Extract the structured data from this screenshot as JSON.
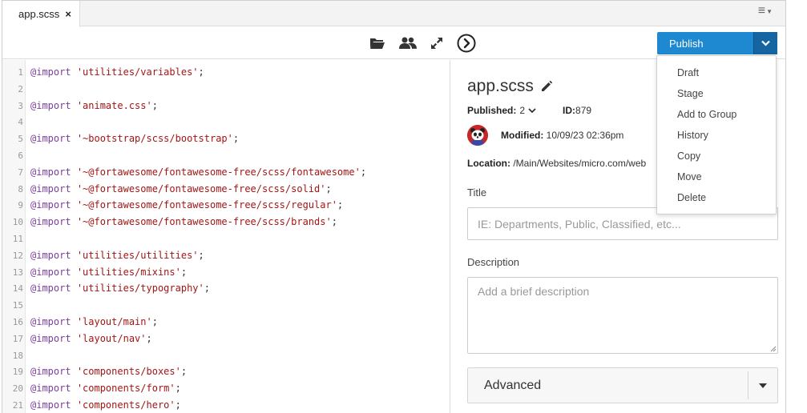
{
  "tab": {
    "title": "app.scss",
    "close_symbol": "×"
  },
  "menu": {
    "icon": "hamburger-menu-icon",
    "glyph": "≡"
  },
  "toolbar": {
    "icons": [
      "folder-open-icon",
      "users-icon",
      "expand-icon",
      "circle-arrow-right-icon"
    ],
    "publish_label": "Publish"
  },
  "dropdown": {
    "items": [
      "Draft",
      "Stage",
      "Add to Group",
      "History",
      "Copy",
      "Move",
      "Delete"
    ]
  },
  "editor": {
    "lines": [
      {
        "num": "1",
        "kw": "@import",
        "str": "'utilities/variables'",
        "end": ";"
      },
      {
        "num": "2",
        "kw": "",
        "str": "",
        "end": ""
      },
      {
        "num": "3",
        "kw": "@import",
        "str": "'animate.css'",
        "end": ";"
      },
      {
        "num": "4",
        "kw": "",
        "str": "",
        "end": ""
      },
      {
        "num": "5",
        "kw": "@import",
        "str": "'~bootstrap/scss/bootstrap'",
        "end": ";"
      },
      {
        "num": "6",
        "kw": "",
        "str": "",
        "end": ""
      },
      {
        "num": "7",
        "kw": "@import",
        "str": "'~@fortawesome/fontawesome-free/scss/fontawesome'",
        "end": ";"
      },
      {
        "num": "8",
        "kw": "@import",
        "str": "'~@fortawesome/fontawesome-free/scss/solid'",
        "end": ";"
      },
      {
        "num": "9",
        "kw": "@import",
        "str": "'~@fortawesome/fontawesome-free/scss/regular'",
        "end": ";"
      },
      {
        "num": "10",
        "kw": "@import",
        "str": "'~@fortawesome/fontawesome-free/scss/brands'",
        "end": ";"
      },
      {
        "num": "11",
        "kw": "",
        "str": "",
        "end": ""
      },
      {
        "num": "12",
        "kw": "@import",
        "str": "'utilities/utilities'",
        "end": ";"
      },
      {
        "num": "13",
        "kw": "@import",
        "str": "'utilities/mixins'",
        "end": ";"
      },
      {
        "num": "14",
        "kw": "@import",
        "str": "'utilities/typography'",
        "end": ";"
      },
      {
        "num": "15",
        "kw": "",
        "str": "",
        "end": ""
      },
      {
        "num": "16",
        "kw": "@import",
        "str": "'layout/main'",
        "end": ";"
      },
      {
        "num": "17",
        "kw": "@import",
        "str": "'layout/nav'",
        "end": ";"
      },
      {
        "num": "18",
        "kw": "",
        "str": "",
        "end": ""
      },
      {
        "num": "19",
        "kw": "@import",
        "str": "'components/boxes'",
        "end": ";"
      },
      {
        "num": "20",
        "kw": "@import",
        "str": "'components/form'",
        "end": ";"
      },
      {
        "num": "21",
        "kw": "@import",
        "str": "'components/hero'",
        "end": ";"
      }
    ]
  },
  "panel": {
    "file_title": "app.scss",
    "published_label": "Published:",
    "published_value": "2",
    "id_label": "ID:",
    "id_value": "879",
    "modified_label": "Modified:",
    "modified_value": "10/09/23 02:36pm",
    "location_label": "Location:",
    "location_value": "/Main/Websites/micro.com/web",
    "title_label": "Title",
    "title_value": "",
    "title_placeholder": "IE: Departments, Public, Classified, etc...",
    "description_label": "Description",
    "description_value": "",
    "description_placeholder": "Add a brief description",
    "advanced_label": "Advanced"
  },
  "colors": {
    "publish": "#1e88d0",
    "publish_drop": "#1565a3",
    "keyword": "#7a3e9d",
    "string": "#a31515"
  }
}
